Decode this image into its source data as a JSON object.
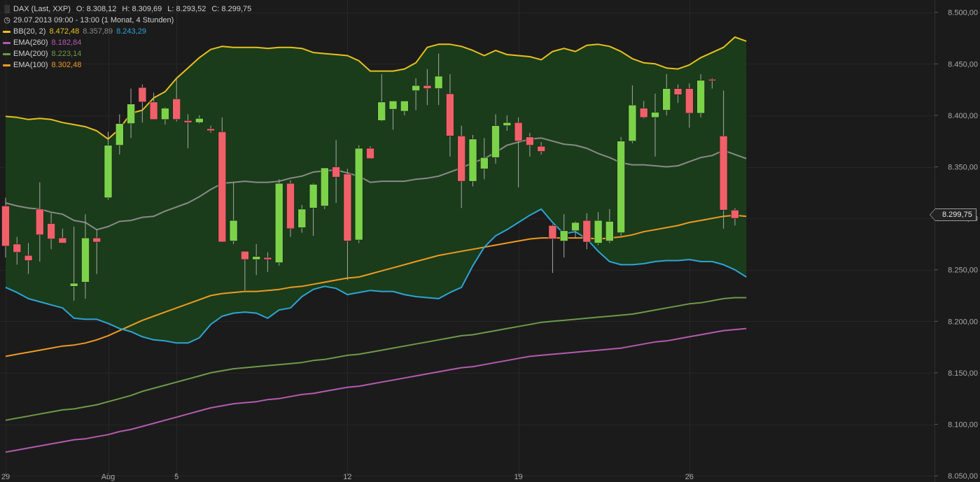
{
  "header": {
    "symbol": "DAX (Last, XXP)",
    "open": "O: 8.308,12",
    "high": "H: 8.309,69",
    "low": "L: 8.293,52",
    "close": "C: 8.299,75",
    "period": "29.07.2013 09:00 - 13:00 (1 Monat, 4 Stunden)"
  },
  "indicators": [
    {
      "label": "BB(20, 2)",
      "value": "8.472,48",
      "value2": "8.357,89",
      "value3": "8.243,29",
      "color": "#e8c020",
      "color2": "#8a8a8a",
      "color3": "#2ea4d6"
    },
    {
      "label": "EMA(260)",
      "value": "8.182,84",
      "color": "#b45bb0"
    },
    {
      "label": "EMA(200)",
      "value": "8.223,14",
      "color": "#6e9a48"
    },
    {
      "label": "EMA(100)",
      "value": "8.302,48",
      "color": "#ee9a22"
    }
  ],
  "last_price": "8.299,75",
  "colors": {
    "up": "#7cd349",
    "down": "#f06068",
    "band_fill": "#1a3c1a",
    "grid": "#262626",
    "background": "#1b1b1b"
  },
  "chart_data": {
    "type": "candlestick",
    "y_axis": {
      "ticks": [
        "8.050,00",
        "8.100,00",
        "8.150,00",
        "8.200,00",
        "8.250,00",
        "8.300,00",
        "8.350,00",
        "8.400,00",
        "8.450,00",
        "8.500,00"
      ],
      "tick_values": [
        8050,
        8100,
        8150,
        8200,
        8250,
        8300,
        8350,
        8400,
        8450,
        8500
      ],
      "ylim": [
        8044,
        8512
      ]
    },
    "x_axis": {
      "labels": [
        "29",
        "Aug",
        "5",
        "12",
        "19",
        "26"
      ],
      "label_index": [
        0,
        9,
        15,
        30,
        45,
        60
      ]
    },
    "candles": [
      {
        "o": 8312,
        "h": 8320,
        "l": 8262,
        "c": 8273
      },
      {
        "o": 8275,
        "h": 8282,
        "l": 8255,
        "c": 8267
      },
      {
        "o": 8264,
        "h": 8276,
        "l": 8246,
        "c": 8259
      },
      {
        "o": 8309,
        "h": 8335,
        "l": 8258,
        "c": 8284
      },
      {
        "o": 8295,
        "h": 8305,
        "l": 8270,
        "c": 8280
      },
      {
        "o": 8281,
        "h": 8290,
        "l": 8276,
        "c": 8276
      },
      {
        "o": 8234,
        "h": 8292,
        "l": 8220,
        "c": 8237
      },
      {
        "o": 8238,
        "h": 8304,
        "l": 8222,
        "c": 8281
      },
      {
        "o": 8281,
        "h": 8289,
        "l": 8246,
        "c": 8277
      },
      {
        "o": 8320,
        "h": 8384,
        "l": 8318,
        "c": 8371
      },
      {
        "o": 8371,
        "h": 8401,
        "l": 8362,
        "c": 8392
      },
      {
        "o": 8392,
        "h": 8426,
        "l": 8378,
        "c": 8411
      },
      {
        "o": 8427,
        "h": 8430,
        "l": 8393,
        "c": 8413
      },
      {
        "o": 8413,
        "h": 8422,
        "l": 8397,
        "c": 8396
      },
      {
        "o": 8396,
        "h": 8408,
        "l": 8391,
        "c": 8407
      },
      {
        "o": 8416,
        "h": 8436,
        "l": 8394,
        "c": 8396
      },
      {
        "o": 8395,
        "h": 8401,
        "l": 8368,
        "c": 8393
      },
      {
        "o": 8393,
        "h": 8400,
        "l": 8392,
        "c": 8397
      },
      {
        "o": 8387,
        "h": 8390,
        "l": 8383,
        "c": 8385
      },
      {
        "o": 8384,
        "h": 8398,
        "l": 8277,
        "c": 8277
      },
      {
        "o": 8278,
        "h": 8335,
        "l": 8275,
        "c": 8298
      },
      {
        "o": 8268,
        "h": 8268,
        "l": 8230,
        "c": 8260
      },
      {
        "o": 8260,
        "h": 8275,
        "l": 8245,
        "c": 8263
      },
      {
        "o": 8262,
        "h": 8267,
        "l": 8248,
        "c": 8260
      },
      {
        "o": 8257,
        "h": 8338,
        "l": 8254,
        "c": 8334
      },
      {
        "o": 8334,
        "h": 8337,
        "l": 8282,
        "c": 8290
      },
      {
        "o": 8291,
        "h": 8313,
        "l": 8286,
        "c": 8309
      },
      {
        "o": 8310,
        "h": 8334,
        "l": 8283,
        "c": 8333
      },
      {
        "o": 8312,
        "h": 8338,
        "l": 8309,
        "c": 8349
      },
      {
        "o": 8350,
        "h": 8376,
        "l": 8315,
        "c": 8340
      },
      {
        "o": 8343,
        "h": 8348,
        "l": 8240,
        "c": 8278
      },
      {
        "o": 8279,
        "h": 8371,
        "l": 8276,
        "c": 8368
      },
      {
        "o": 8368,
        "h": 8370,
        "l": 8358,
        "c": 8358
      },
      {
        "o": 8395,
        "h": 8440,
        "l": 8394,
        "c": 8413
      },
      {
        "o": 8406,
        "h": 8410,
        "l": 8386,
        "c": 8414
      },
      {
        "o": 8404,
        "h": 8414,
        "l": 8400,
        "c": 8414
      },
      {
        "o": 8424,
        "h": 8436,
        "l": 8405,
        "c": 8429
      },
      {
        "o": 8429,
        "h": 8445,
        "l": 8410,
        "c": 8426
      },
      {
        "o": 8426,
        "h": 8460,
        "l": 8410,
        "c": 8438
      },
      {
        "o": 8421,
        "h": 8440,
        "l": 8360,
        "c": 8380
      },
      {
        "o": 8380,
        "h": 8390,
        "l": 8310,
        "c": 8336
      },
      {
        "o": 8336,
        "h": 8381,
        "l": 8331,
        "c": 8377
      },
      {
        "o": 8348,
        "h": 8378,
        "l": 8338,
        "c": 8359
      },
      {
        "o": 8359,
        "h": 8401,
        "l": 8353,
        "c": 8390
      },
      {
        "o": 8390,
        "h": 8400,
        "l": 8385,
        "c": 8393
      },
      {
        "o": 8393,
        "h": 8398,
        "l": 8330,
        "c": 8375
      },
      {
        "o": 8379,
        "h": 8383,
        "l": 8360,
        "c": 8371
      },
      {
        "o": 8370,
        "h": 8374,
        "l": 8362,
        "c": 8365
      },
      {
        "o": 8293,
        "h": 8294,
        "l": 8247,
        "c": 8280
      },
      {
        "o": 8278,
        "h": 8304,
        "l": 8262,
        "c": 8288
      },
      {
        "o": 8288,
        "h": 8297,
        "l": 8281,
        "c": 8296
      },
      {
        "o": 8298,
        "h": 8305,
        "l": 8270,
        "c": 8277
      },
      {
        "o": 8276,
        "h": 8306,
        "l": 8274,
        "c": 8298
      },
      {
        "o": 8278,
        "h": 8309,
        "l": 8276,
        "c": 8297
      },
      {
        "o": 8286,
        "h": 8379,
        "l": 8283,
        "c": 8375
      },
      {
        "o": 8375,
        "h": 8429,
        "l": 8373,
        "c": 8410
      },
      {
        "o": 8407,
        "h": 8414,
        "l": 8397,
        "c": 8398
      },
      {
        "o": 8398,
        "h": 8421,
        "l": 8360,
        "c": 8403
      },
      {
        "o": 8405,
        "h": 8440,
        "l": 8400,
        "c": 8426
      },
      {
        "o": 8426,
        "h": 8430,
        "l": 8412,
        "c": 8420
      },
      {
        "o": 8426,
        "h": 8431,
        "l": 8388,
        "c": 8402
      },
      {
        "o": 8402,
        "h": 8440,
        "l": 8398,
        "c": 8434
      },
      {
        "o": 8435,
        "h": 8436,
        "l": 8426,
        "c": 8434
      },
      {
        "o": 8380,
        "h": 8424,
        "l": 8290,
        "c": 8308
      },
      {
        "o": 8308,
        "h": 8310,
        "l": 8293,
        "c": 8300
      }
    ],
    "series": [
      {
        "name": "BB(20, 2)",
        "role": "upper",
        "color": "#e8c020",
        "values": [
          8399,
          8398,
          8396,
          8397,
          8396,
          8393,
          8391,
          8389,
          8385,
          8377,
          8387,
          8402,
          8405,
          8417,
          8423,
          8436,
          8446,
          8456,
          8464,
          8467,
          8466,
          8466,
          8466,
          8465,
          8466,
          8466,
          8465,
          8461,
          8460,
          8459,
          8458,
          8453,
          8443,
          8443,
          8443,
          8445,
          8451,
          8466,
          8469,
          8469,
          8467,
          8463,
          8458,
          8463,
          8459,
          8458,
          8457,
          8454,
          8462,
          8465,
          8462,
          8468,
          8469,
          8467,
          8462,
          8455,
          8451,
          8450,
          8446,
          8445,
          8449,
          8456,
          8461,
          8466,
          8476,
          8472
        ]
      },
      {
        "name": "",
        "role": "middle",
        "color": "#8a8a8a",
        "values": [
          8315,
          8312,
          8310,
          8309,
          8306,
          8304,
          8298,
          8296,
          8289,
          8292,
          8297,
          8298,
          8301,
          8302,
          8307,
          8311,
          8315,
          8321,
          8328,
          8334,
          8335,
          8336,
          8335,
          8335,
          8336,
          8339,
          8341,
          8345,
          8346,
          8347,
          8344,
          8341,
          8335,
          8336,
          8336,
          8336,
          8338,
          8339,
          8341,
          8345,
          8349,
          8354,
          8358,
          8364,
          8371,
          8374,
          8377,
          8378,
          8375,
          8372,
          8371,
          8368,
          8363,
          8359,
          8354,
          8352,
          8352,
          8351,
          8350,
          8351,
          8355,
          8359,
          8361,
          8366,
          8362,
          8358
        ]
      },
      {
        "name": "",
        "role": "lower",
        "color": "#2ea4d6",
        "values": [
          8233,
          8228,
          8222,
          8219,
          8216,
          8213,
          8203,
          8202,
          8202,
          8198,
          8193,
          8190,
          8185,
          8182,
          8181,
          8179,
          8179,
          8184,
          8197,
          8205,
          8208,
          8209,
          8208,
          8203,
          8211,
          8213,
          8224,
          8231,
          8234,
          8232,
          8226,
          8228,
          8230,
          8229,
          8229,
          8226,
          8224,
          8223,
          8222,
          8228,
          8233,
          8254,
          8272,
          8283,
          8289,
          8296,
          8303,
          8309,
          8296,
          8285,
          8287,
          8280,
          8268,
          8258,
          8255,
          8255,
          8256,
          8258,
          8259,
          8259,
          8260,
          8258,
          8258,
          8255,
          8250,
          8243
        ]
      },
      {
        "name": "EMA(260)",
        "color": "#b45bb0",
        "values": [
          8073,
          8075,
          8077,
          8079,
          8081,
          8083,
          8085,
          8086,
          8088,
          8090,
          8093,
          8095,
          8098,
          8101,
          8104,
          8107,
          8110,
          8113,
          8116,
          8118,
          8120,
          8121,
          8122,
          8124,
          8125,
          8127,
          8129,
          8130,
          8132,
          8134,
          8136,
          8137,
          8139,
          8141,
          8143,
          8145,
          8147,
          8149,
          8151,
          8153,
          8155,
          8156,
          8158,
          8160,
          8162,
          8164,
          8166,
          8167,
          8168,
          8169,
          8170,
          8171,
          8172,
          8173,
          8174,
          8176,
          8178,
          8180,
          8181,
          8183,
          8185,
          8187,
          8189,
          8191,
          8192,
          8193
        ]
      },
      {
        "name": "EMA(200)",
        "color": "#6e9a48",
        "values": [
          8104,
          8106,
          8108,
          8110,
          8112,
          8114,
          8115,
          8117,
          8119,
          8122,
          8125,
          8128,
          8132,
          8135,
          8138,
          8141,
          8144,
          8147,
          8150,
          8152,
          8154,
          8155,
          8156,
          8157,
          8158,
          8159,
          8160,
          8162,
          8163,
          8165,
          8167,
          8168,
          8170,
          8172,
          8174,
          8176,
          8178,
          8180,
          8182,
          8184,
          8186,
          8187,
          8189,
          8191,
          8193,
          8195,
          8197,
          8199,
          8200,
          8201,
          8202,
          8203,
          8204,
          8205,
          8206,
          8207,
          8209,
          8211,
          8213,
          8215,
          8217,
          8218,
          8220,
          8222,
          8223,
          8223
        ]
      },
      {
        "name": "EMA(100)",
        "color": "#ee9a22",
        "values": [
          8166,
          8168,
          8170,
          8172,
          8174,
          8176,
          8177,
          8179,
          8182,
          8186,
          8191,
          8196,
          8201,
          8205,
          8209,
          8213,
          8217,
          8221,
          8225,
          8227,
          8228,
          8229,
          8229,
          8230,
          8231,
          8233,
          8234,
          8236,
          8238,
          8240,
          8242,
          8243,
          8246,
          8249,
          8252,
          8255,
          8258,
          8261,
          8264,
          8266,
          8268,
          8270,
          8272,
          8274,
          8276,
          8278,
          8280,
          8281,
          8281,
          8281,
          8281,
          8281,
          8280,
          8281,
          8282,
          8284,
          8287,
          8289,
          8291,
          8293,
          8296,
          8298,
          8300,
          8302,
          8303,
          8302
        ]
      }
    ]
  }
}
